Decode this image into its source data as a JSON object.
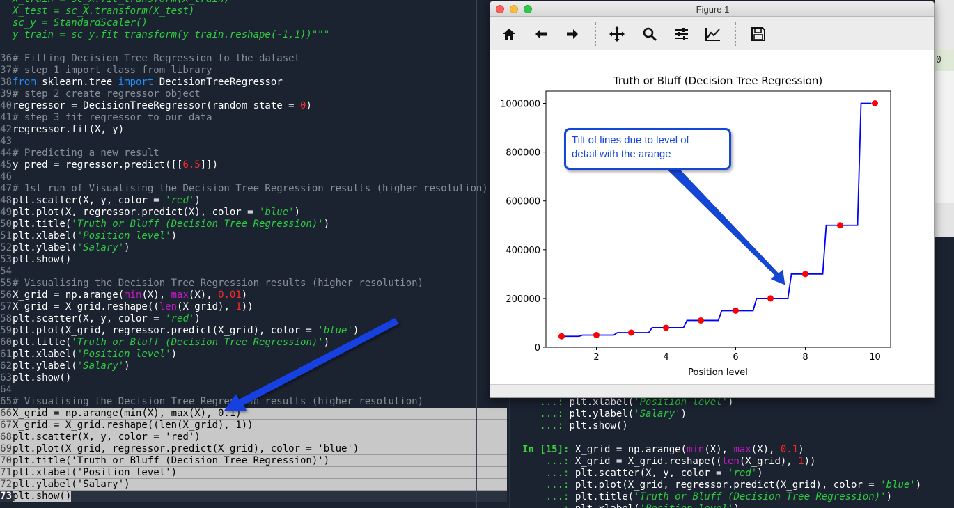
{
  "editor": {
    "lines": [
      {
        "n": "",
        "html": "<span class='green-it'>X_train = sc_X.fit_transform(X_train)</span>",
        "top": -9
      },
      {
        "n": "",
        "html": "<span class='green-it'>X_test = sc_X.transform(X_test)</span>",
        "top": 8
      },
      {
        "n": "",
        "html": "<span class='green-it'>sc_y = StandardScaler()</span>",
        "top": 25
      },
      {
        "n": "",
        "html": "<span class='green-it'>y_train = sc_y.fit_transform(y_train.reshape(-1,1))\"\"\"</span>",
        "top": 42
      },
      {
        "n": "",
        "html": "",
        "top": 59
      },
      {
        "n": "36",
        "html": "<span class='cm'># Fitting Decision Tree Regression to the dataset</span>",
        "top": 76
      },
      {
        "n": "37",
        "html": "<span class='cm'># step 1 import class from library</span>",
        "top": 93
      },
      {
        "n": "38",
        "html": "<span class='kw'>from</span> sklearn.tree <span class='kw'>import</span> DecisionTreeRegressor",
        "top": 110
      },
      {
        "n": "39",
        "html": "<span class='cm'># step 2 create regressor object</span>",
        "top": 127
      },
      {
        "n": "40",
        "html": "regressor = DecisionTreeRegressor(random_state = <span class='num'>0</span>)",
        "top": 144
      },
      {
        "n": "41",
        "html": "<span class='cm'># step 3 fit regressor to our data</span>",
        "top": 161
      },
      {
        "n": "42",
        "html": "regressor.fit(X, y)",
        "top": 178
      },
      {
        "n": "43",
        "html": "",
        "top": 195
      },
      {
        "n": "44",
        "html": "<span class='cm'># Predicting a new result</span>",
        "top": 212
      },
      {
        "n": "45",
        "html": "y_pred = regressor.predict([[<span class='num'>6.5</span>]])",
        "top": 229
      },
      {
        "n": "46",
        "html": "",
        "top": 246
      },
      {
        "n": "47",
        "html": "<span class='cm'># 1st run of Visualising the Decision Tree Regression results (higher resolution)</span>",
        "top": 263
      },
      {
        "n": "48",
        "html": "plt.scatter(X, y, color = <span class='str'>'red'</span>)",
        "top": 280
      },
      {
        "n": "49",
        "html": "plt.plot(X, regressor.predict(X), color = <span class='str'>'blue'</span>)",
        "top": 297
      },
      {
        "n": "50",
        "html": "plt.title(<span class='str'>'Truth or Bluff (Decision Tree Regression)'</span>)",
        "top": 314
      },
      {
        "n": "51",
        "html": "plt.xlabel(<span class='str'>'Position level'</span>)",
        "top": 331
      },
      {
        "n": "52",
        "html": "plt.ylabel(<span class='str'>'Salary'</span>)",
        "top": 348
      },
      {
        "n": "53",
        "html": "plt.show()",
        "top": 365
      },
      {
        "n": "54",
        "html": "",
        "top": 382
      },
      {
        "n": "55",
        "html": "<span class='cm'># Visualising the Decision Tree Regression results (higher resolution)</span>",
        "top": 399
      },
      {
        "n": "56",
        "html": "X_grid = np.arange(<span class='bi'>min</span>(X), <span class='bi'>max</span>(X), <span class='num'>0.01</span>)",
        "top": 416
      },
      {
        "n": "57",
        "html": "X_grid = X_grid.reshape((<span class='bi'>len</span>(X_grid), <span class='num'>1</span>))",
        "top": 433
      },
      {
        "n": "58",
        "html": "plt.scatter(X, y, color = <span class='str'>'red'</span>)",
        "top": 450
      },
      {
        "n": "59",
        "html": "plt.plot(X_grid, regressor.predict(X_grid), color = <span class='str'>'blue'</span>)",
        "top": 467
      },
      {
        "n": "60",
        "html": "plt.title(<span class='str'>'Truth or Bluff (Decision Tree Regression)'</span>)",
        "top": 484
      },
      {
        "n": "61",
        "html": "plt.xlabel(<span class='str'>'Position level'</span>)",
        "top": 501
      },
      {
        "n": "62",
        "html": "plt.ylabel(<span class='str'>'Salary'</span>)",
        "top": 518
      },
      {
        "n": "63",
        "html": "plt.show()",
        "top": 535
      },
      {
        "n": "64",
        "html": "",
        "top": 552
      },
      {
        "n": "65",
        "html": "<span class='cm'># Visualising the Decision Tree Regression results (higher resolution)</span>",
        "top": 569
      }
    ],
    "selected_lines": [
      {
        "n": "66",
        "text": "X_grid = np.arange(min(X), max(X), 0.1)"
      },
      {
        "n": "67",
        "text": "X_grid = X_grid.reshape((len(X_grid), 1))"
      },
      {
        "n": "68",
        "text": "plt.scatter(X, y, color = 'red')"
      },
      {
        "n": "69",
        "text": "plt.plot(X_grid, regressor.predict(X_grid), color = 'blue')"
      },
      {
        "n": "70",
        "text": "plt.title('Truth or Bluff (Decision Tree Regression)')"
      },
      {
        "n": "71",
        "text": "plt.xlabel('Position level')"
      },
      {
        "n": "72",
        "text": "plt.ylabel('Salary')"
      }
    ],
    "current_line": {
      "n": "73",
      "text": "plt.show()"
    }
  },
  "console": {
    "lines": [
      {
        "kind": "cont",
        "prefix": "   ...: ",
        "html": "plt.xlabel(<span class='str'>'Position level'</span>)"
      },
      {
        "kind": "cont",
        "prefix": "   ...: ",
        "html": "plt.ylabel(<span class='str'>'Salary'</span>)"
      },
      {
        "kind": "cont",
        "prefix": "   ...: ",
        "html": "plt.show()"
      },
      {
        "kind": "blank",
        "prefix": "",
        "html": ""
      },
      {
        "kind": "prompt",
        "prefix": "In [15]: ",
        "html": "X_grid = np.arange(<span class='bi'>min</span>(X), <span class='bi'>max</span>(X), <span class='num'>0.1</span>)"
      },
      {
        "kind": "cont",
        "prefix": "    ...: ",
        "html": "X_grid = X_grid.reshape((<span class='bi'>len</span>(X_grid), <span class='num'>1</span>))"
      },
      {
        "kind": "cont",
        "prefix": "    ...: ",
        "html": "plt.scatter(X, y, color = <span class='str'>'red'</span>)"
      },
      {
        "kind": "cont",
        "prefix": "    ...: ",
        "html": "plt.plot(X_grid, regressor.predict(X_grid), color = <span class='str'>'blue'</span>)"
      },
      {
        "kind": "cont",
        "prefix": "    ...: ",
        "html": "plt.title(<span class='str'>'Truth or Bluff (Decision Tree Regression)'</span>)"
      },
      {
        "kind": "cont",
        "prefix": "    ...: ",
        "html": "plt.xlabel(<span class='str'>'Position level'</span>)"
      }
    ]
  },
  "figure_window": {
    "title": "Figure 1",
    "toolbar": [
      "home-icon",
      "back-icon",
      "forward-icon",
      "pan-icon",
      "zoom-icon",
      "configure-subplots-icon",
      "edit-axis-icon",
      "save-icon"
    ]
  },
  "right_strip": {
    "partial_text": "0"
  },
  "callout": {
    "text_line1": "Tilt of lines due to level of",
    "text_line2": "detail with the arange",
    "color": "#1447d6"
  },
  "chart_data": {
    "type": "line",
    "title": "Truth or Bluff (Decision Tree Regression)",
    "xlabel": "Position level",
    "ylabel": "",
    "xlim": [
      0.55,
      10.45
    ],
    "ylim": [
      0,
      1050000
    ],
    "xticks": [
      2,
      4,
      6,
      8,
      10
    ],
    "yticks": [
      0,
      200000,
      400000,
      600000,
      800000,
      1000000
    ],
    "ytick_labels": [
      "0",
      "200000",
      "400000",
      "600000",
      "800000",
      "1000000"
    ],
    "scatter": {
      "color": "#ff0000",
      "x": [
        1,
        2,
        3,
        4,
        5,
        6,
        7,
        8,
        9,
        10
      ],
      "y": [
        45000,
        50000,
        60000,
        80000,
        110000,
        150000,
        200000,
        300000,
        500000,
        1000000
      ]
    },
    "line": {
      "color": "#0000ff",
      "grid_step": 0.1,
      "x_start": 1.0,
      "x_end": 9.9,
      "steps": [
        {
          "from": 1.0,
          "to": 1.5,
          "y": 45000
        },
        {
          "from": 1.6,
          "to": 2.5,
          "y": 50000
        },
        {
          "from": 2.6,
          "to": 3.5,
          "y": 60000
        },
        {
          "from": 3.6,
          "to": 4.5,
          "y": 80000
        },
        {
          "from": 4.6,
          "to": 5.5,
          "y": 110000
        },
        {
          "from": 5.6,
          "to": 6.5,
          "y": 150000
        },
        {
          "from": 6.6,
          "to": 7.5,
          "y": 200000
        },
        {
          "from": 7.6,
          "to": 8.5,
          "y": 300000
        },
        {
          "from": 8.6,
          "to": 9.5,
          "y": 500000
        },
        {
          "from": 9.6,
          "to": 9.9,
          "y": 1000000
        }
      ]
    }
  }
}
